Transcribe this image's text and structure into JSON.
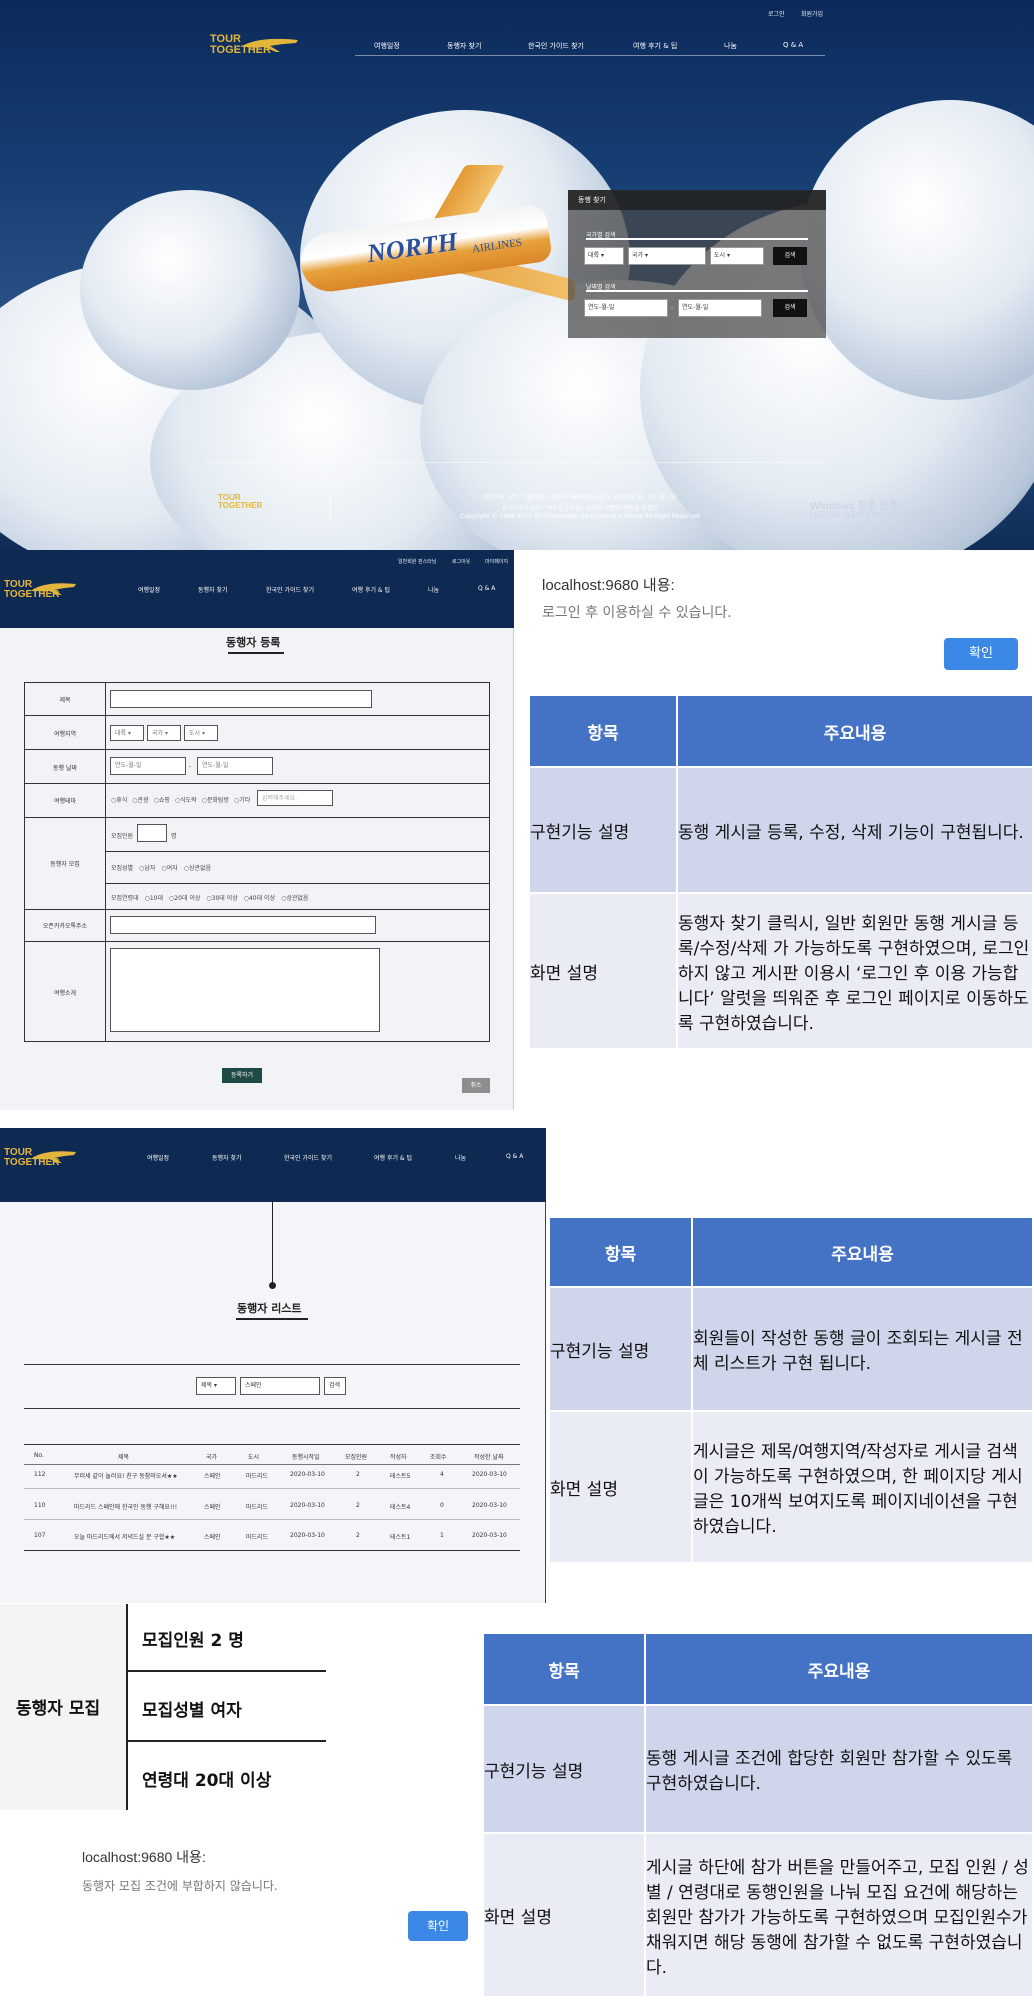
{
  "hero": {
    "top_links": [
      "로그인",
      "회원가입"
    ],
    "logo_line1": "TOUR",
    "logo_line2": "TOGETHER",
    "nav": [
      "여행일정",
      "동행자 찾기",
      "한국인 가이드 찾기",
      "여행 후기 & 팁",
      "나눔",
      "Q & A"
    ],
    "plane_text": "NORTH",
    "plane_text2": "AIRLINES",
    "search": {
      "title": "동행 찾기",
      "country_label": "국가별 검색",
      "continent": "대륙",
      "country": "국가",
      "city": "도시",
      "search_btn": "검색",
      "date_label": "날짜별 검색",
      "date_from": "연도-월-일",
      "date_sep": "-",
      "date_to": "연도-월-일",
      "search_btn2": "검색"
    },
    "footer": {
      "line1": "강남지원 1관 : 서울특별시 강남구 테헤란로14길 6 남도빌딩 2F, 3F, 4F, 5F",
      "line2": "같이가조 | 조장 : 박유진 | 조원 : 김동현 김편조 곽한솔 김경진",
      "line3": "Copyright © 1998-2020 KH Information Educational Institute All Right Reserved"
    },
    "watermark1": "Windows 정품 인증",
    "watermark2": "[설정]으로 이동하여 Windows를 정품 인증합니다."
  },
  "form": {
    "top_links": [
      "일반회원 핀스타님",
      "로그아웃",
      "마이페이지"
    ],
    "nav": [
      "여행일정",
      "동행자 찾기",
      "한국인 가이드 찾기",
      "여행 후기 & 팁",
      "나눔",
      "Q & A"
    ],
    "title": "동행자 등록",
    "rows": {
      "title": "제목",
      "region": "여행지역",
      "date": "동행 날짜",
      "theme": "여행테마",
      "recruit": "동행자 모집",
      "kakao": "오픈카카오톡주소",
      "intro": "여행소개"
    },
    "region_opts": [
      "대륙",
      "국가",
      "도시"
    ],
    "date_from": "연도-월-일",
    "date_sep": "-",
    "date_to": "연도-월-일",
    "themes": [
      "휴식",
      "관광",
      "쇼핑",
      "식도락",
      "문화탐방",
      "기타"
    ],
    "theme_placeholder": "입력해주세요.",
    "recruit_count_label": "모집인원",
    "recruit_unit": "명",
    "recruit_gender_label": "모집성별",
    "genders": [
      "남자",
      "여자",
      "상관없음"
    ],
    "recruit_age_label": "모집연령대",
    "ages": [
      "10대",
      "20대 이상",
      "30대 이상",
      "40대 이상",
      "상관없음"
    ],
    "submit": "등록하기",
    "cancel": "취소"
  },
  "alert1": {
    "title": "localhost:9680 내용:",
    "message": "로그인 후 이용하실 수 있습니다.",
    "ok": "확인"
  },
  "table1": {
    "h1": "항목",
    "h2": "주요내용",
    "r1k": "구현기능 설명",
    "r1v": "동행 게시글 등록, 수정, 삭제 기능이 구현됩니다.",
    "r2k": "화면 설명",
    "r2v": "동행자 찾기 클릭시, 일반 회원만 동행 게시글 등록/수정/삭제 가 가능하도록 구현하였으며, 로그인 하지 않고 게시판 이용시 ‘로그인 후 이용 가능합니다’ 알럿을 띄워준 후 로그인 페이지로 이동하도록 구현하였습니다."
  },
  "list": {
    "nav": [
      "여행일정",
      "동행자 찾기",
      "한국인 가이드 찾기",
      "여행 후기 & 팁",
      "나눔",
      "Q & A"
    ],
    "title": "동행자 리스트",
    "filter": "제목",
    "keyword": "스페인",
    "search_btn": "검색",
    "headers": [
      "No.",
      "제목",
      "국가",
      "도시",
      "동행시작일",
      "모집인원",
      "작성자",
      "조회수",
      "작성한 날짜"
    ],
    "rows": [
      [
        "112",
        "무러세 같이 놀러요! 친구 동참마오셔★★",
        "스페인",
        "마드리드",
        "2020-03-10",
        "2",
        "테스트5",
        "4",
        "2020-03-10"
      ],
      [
        "110",
        "마드리드 스페인에 한국인 동행 구해요!!!",
        "스페인",
        "마드리드",
        "2020-03-10",
        "2",
        "테스트4",
        "0",
        "2020-03-10"
      ],
      [
        "107",
        "오늘 마드리드에서 저녁드실 분 구합★★",
        "스페인",
        "마드리드",
        "2020-03-10",
        "2",
        "테스트1",
        "1",
        "2020-03-10"
      ]
    ]
  },
  "table2": {
    "h1": "항목",
    "h2": "주요내용",
    "r1k": "구현기능 설명",
    "r1v": "회원들이 작성한 동행 글이 조회되는 게시글 전체 리스트가 구현 됩니다.",
    "r2k": "화면 설명",
    "r2v": "게시글은 제목/여행지역/작성자로 게시글 검색이 가능하도록 구현하였으며, 한 페이지당 게시글은 10개씩 보여지도록 페이지네이션을 구현하였습니다."
  },
  "recruit": {
    "label": "동행자 모집",
    "count": "모집인원   2 명",
    "gender": "모집성별   여자",
    "age": "연령대   20대 이상"
  },
  "alert2": {
    "title": "localhost:9680 내용:",
    "message": "동행자 모집 조건에 부합하지 않습니다.",
    "ok": "확인"
  },
  "table3": {
    "h1": "항목",
    "h2": "주요내용",
    "r1k": "구현기능 설명",
    "r1v": "동행 게시글 조건에 합당한 회원만 참가할 수 있도록 구현하였습니다.",
    "r2k": "화면 설명",
    "r2v": "게시글 하단에 참가 버튼을 만들어주고, 모집 인원 / 성별 / 연령대로 동행인원을 나눠 모집 요건에 해당하는 회원만 참가가 가능하도록 구현하였으며 모집인원수가 채워지면 해당 동행에 참가할 수 없도록 구현하였습니다."
  },
  "colors": {
    "nav_dark": "#0e2a52",
    "accent_blue": "#4472c4",
    "logo_gold": "#e3b63b",
    "ok_blue": "#3c88e6"
  }
}
